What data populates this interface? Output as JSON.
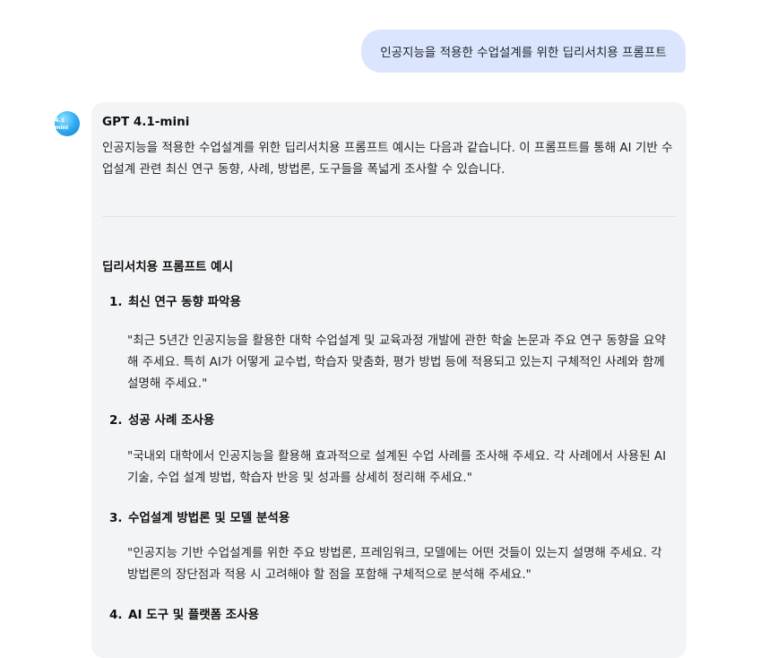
{
  "user_message": "인공지능을 적용한 수업설계를 위한 딥리서치용 프롬프트",
  "assistant": {
    "avatar_label": "4.1 mini",
    "model_name": "GPT 4.1-mini",
    "intro": "인공지능을 적용한 수업설계를 위한 딥리서치용 프롬프트 예시는 다음과 같습니다. 이 프롬프트를 통해 AI 기반 수업설계 관련 최신 연구 동향, 사례, 방법론, 도구들을 폭넓게 조사할 수 있습니다.",
    "section_heading": "딥리서치용 프롬프트 예시",
    "items": [
      {
        "number": "1.",
        "title": "최신 연구 동향 파악용",
        "body": "\"최근 5년간 인공지능을 활용한 대학 수업설계 및 교육과정 개발에 관한 학술 논문과 주요 연구 동향을 요약해 주세요. 특히 AI가 어떻게 교수법, 학습자 맞춤화, 평가 방법 등에 적용되고 있는지 구체적인 사례와 함께 설명해 주세요.\""
      },
      {
        "number": "2.",
        "title": "성공 사례 조사용",
        "body": "\"국내외 대학에서 인공지능을 활용해 효과적으로 설계된 수업 사례를 조사해 주세요. 각 사례에서 사용된 AI 기술, 수업 설계 방법, 학습자 반응 및 성과를 상세히 정리해 주세요.\""
      },
      {
        "number": "3.",
        "title": "수업설계 방법론 및 모델 분석용",
        "body": "\"인공지능 기반 수업설계를 위한 주요 방법론, 프레임워크, 모델에는 어떤 것들이 있는지 설명해 주세요. 각 방법론의 장단점과 적용 시 고려해야 할 점을 포함해 구체적으로 분석해 주세요.\""
      },
      {
        "number": "4.",
        "title": "AI 도구 및 플랫폼 조사용",
        "body": ""
      }
    ]
  }
}
